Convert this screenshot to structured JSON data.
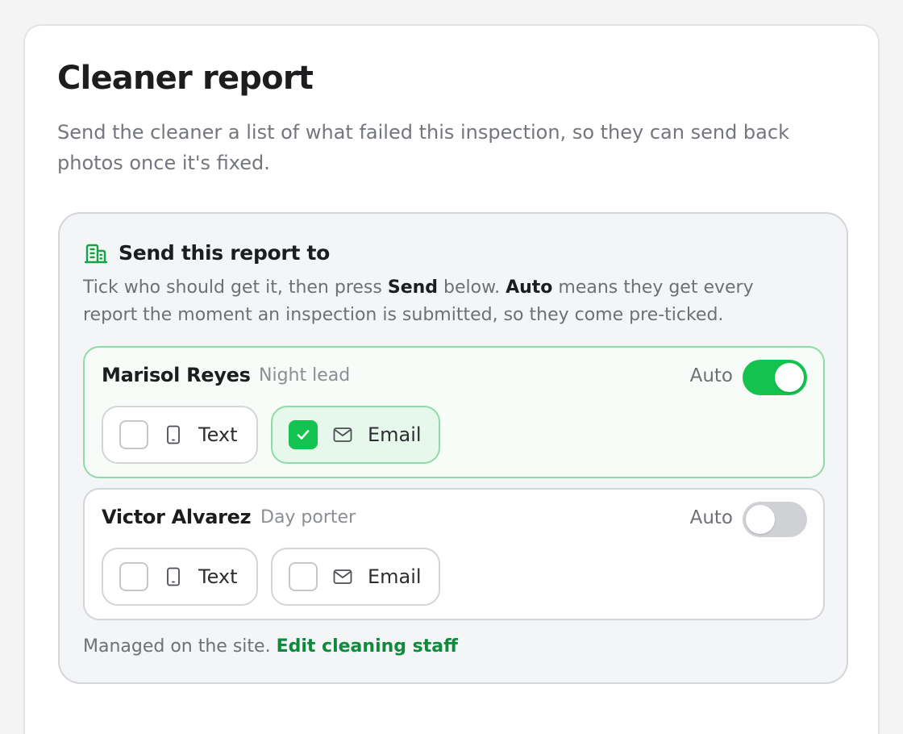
{
  "card": {
    "title": "Cleaner report",
    "description": "Send the cleaner a list of what failed this inspection, so they can send back photos once it's fixed."
  },
  "panel": {
    "icon": "building-icon",
    "title": "Send this report to",
    "desc_part1": "Tick who should get it, then press ",
    "desc_send": "Send",
    "desc_part2": " below. ",
    "desc_auto": "Auto",
    "desc_part3": " means they get every report the moment an inspection is submitted, so they come pre-ticked."
  },
  "recipients": [
    {
      "name": "Marisol Reyes",
      "role": "Night lead",
      "auto_label": "Auto",
      "auto_on": true,
      "text": {
        "label": "Text",
        "icon": "phone-icon",
        "checked": false
      },
      "email": {
        "label": "Email",
        "icon": "mail-icon",
        "checked": true
      }
    },
    {
      "name": "Victor Alvarez",
      "role": "Day porter",
      "auto_label": "Auto",
      "auto_on": false,
      "text": {
        "label": "Text",
        "icon": "phone-icon",
        "checked": false
      },
      "email": {
        "label": "Email",
        "icon": "mail-icon",
        "checked": false
      }
    }
  ],
  "footer": {
    "text": "Managed on the site. ",
    "link": "Edit cleaning staff"
  },
  "colors": {
    "accent": "#14c24f",
    "link": "#0e8a3c",
    "active_border": "#8fdba6"
  }
}
